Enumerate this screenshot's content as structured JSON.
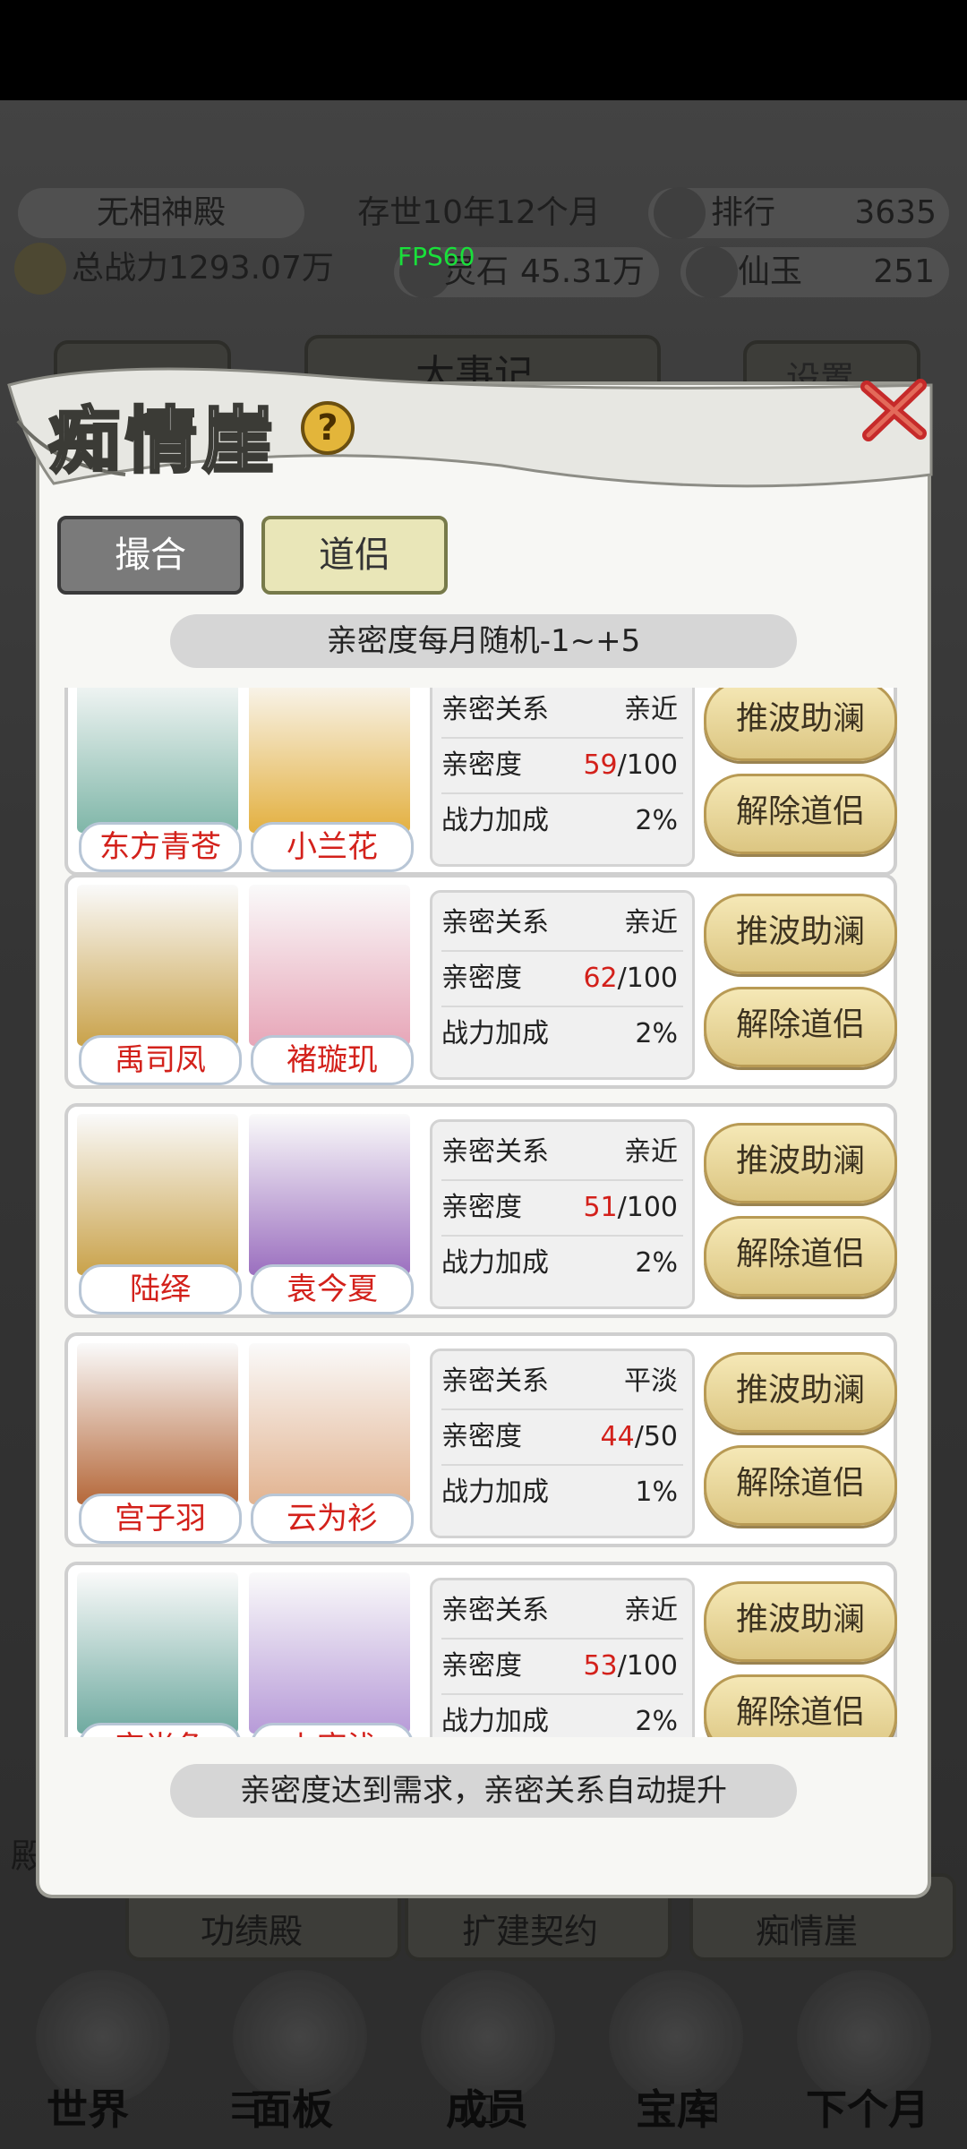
{
  "top_bar": {
    "sect_name": "无相神殿",
    "time_in_world": "存世10年12个月",
    "rank_label": "排行",
    "rank_value": "3635",
    "total_power": "总战力1293.07万",
    "spirit_stone_label": "灵石",
    "spirit_stone_value": "45.31万",
    "jade_label": "仙玉",
    "jade_value": "251",
    "fps": "FPS60"
  },
  "modal": {
    "title": "痴情崖",
    "help": "?",
    "tabs": [
      "撮合",
      "道侣"
    ],
    "active_tab": "道侣",
    "intimacy_note": "亲密度每月随机-1~+5",
    "footer_note": "亲密度达到需求，亲密关系自动提升",
    "labels": {
      "relation": "亲密关系",
      "intimacy": "亲密度",
      "power_bonus": "战力加成"
    },
    "buttons": {
      "boost": "推波助澜",
      "dissolve": "解除道侣"
    },
    "couples": [
      {
        "left_name": "东方青苍",
        "right_name": "小兰花",
        "relation": "亲近",
        "intimacy": "59",
        "intimacy_max": "/100",
        "bonus": "2%"
      },
      {
        "left_name": "禹司凤",
        "right_name": "褚璇玑",
        "relation": "亲近",
        "intimacy": "62",
        "intimacy_max": "/100",
        "bonus": "2%"
      },
      {
        "left_name": "陆绎",
        "right_name": "袁今夏",
        "relation": "亲近",
        "intimacy": "51",
        "intimacy_max": "/100",
        "bonus": "2%"
      },
      {
        "left_name": "宫子羽",
        "right_name": "云为衫",
        "relation": "平淡",
        "intimacy": "44",
        "intimacy_max": "/50",
        "bonus": "1%"
      },
      {
        "left_name": "宫尚角",
        "right_name": "上官浅",
        "relation": "亲近",
        "intimacy": "53",
        "intimacy_max": "/100",
        "bonus": "2%"
      }
    ]
  },
  "background": {
    "partial_texts": [
      "大事记",
      "设置",
      "殿",
      "功绩殿",
      "扩建契约",
      "痴情崖"
    ]
  },
  "bottom_nav": {
    "items": [
      "世界",
      "面板",
      "成员",
      "宝库",
      "下个月"
    ]
  },
  "colors": {
    "accent_red": "#d3211b",
    "gold_button": "#e8d494",
    "fps_green": "#19e03a"
  }
}
